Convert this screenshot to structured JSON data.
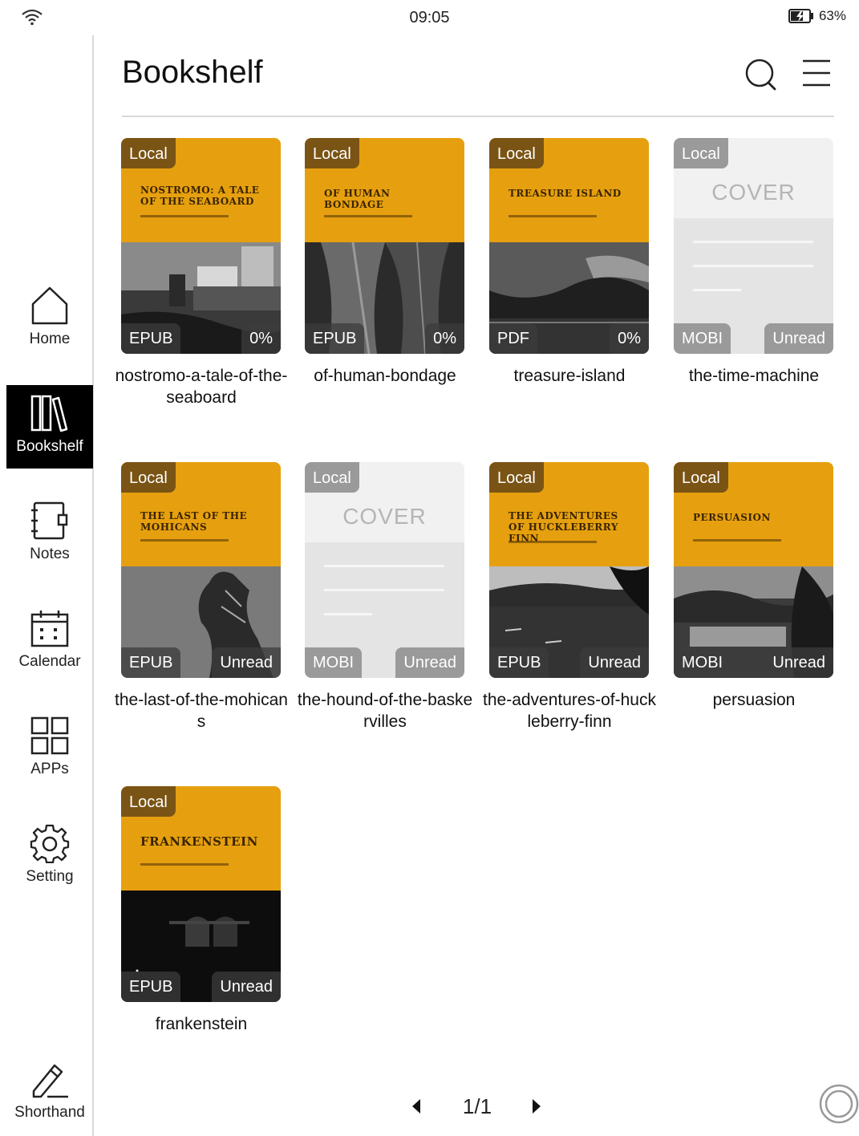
{
  "status_bar": {
    "time": "09:05",
    "battery": "63%"
  },
  "header": {
    "title": "Bookshelf"
  },
  "sidebar": {
    "items": [
      {
        "label": "Home"
      },
      {
        "label": "Bookshelf"
      },
      {
        "label": "Notes"
      },
      {
        "label": "Calendar"
      },
      {
        "label": "APPs"
      },
      {
        "label": "Setting"
      },
      {
        "label": "Shorthand"
      }
    ]
  },
  "books": [
    {
      "name": "nostromo-a-tale-of-the-seaboard",
      "source": "Local",
      "format": "EPUB",
      "status": "0%",
      "cover_title": "Nostromo: A Tale of the Seaboard",
      "cover": "image"
    },
    {
      "name": "of-human-bondage",
      "source": "Local",
      "format": "EPUB",
      "status": "0%",
      "cover_title": "Of Human Bondage",
      "cover": "image"
    },
    {
      "name": "treasure-island",
      "source": "Local",
      "format": "PDF",
      "status": "0%",
      "cover_title": "Treasure Island",
      "cover": "image"
    },
    {
      "name": "the-time-machine",
      "source": "Local",
      "format": "MOBI",
      "status": "Unread",
      "cover_title": "",
      "cover": "placeholder",
      "placeholder_word": "COVER"
    },
    {
      "name": "the-last-of-the-mohicans",
      "source": "Local",
      "format": "EPUB",
      "status": "Unread",
      "cover_title": "The Last of the Mohicans",
      "cover": "image"
    },
    {
      "name": "the-hound-of-the-baskervilles",
      "source": "Local",
      "format": "MOBI",
      "status": "Unread",
      "cover_title": "",
      "cover": "placeholder",
      "placeholder_word": "COVER"
    },
    {
      "name": "the-adventures-of-huckleberry-finn",
      "source": "Local",
      "format": "EPUB",
      "status": "Unread",
      "cover_title": "The Adventures of Huckleberry Finn",
      "cover": "image"
    },
    {
      "name": "persuasion",
      "source": "Local",
      "format": "MOBI",
      "status": "Unread",
      "cover_title": "Persuasion",
      "cover": "image"
    },
    {
      "name": "frankenstein",
      "source": "Local",
      "format": "EPUB",
      "status": "Unread",
      "cover_title": "Frankenstein",
      "cover": "image"
    }
  ],
  "pager": {
    "label": "1/1"
  },
  "colors": {
    "cover_accent": "#e6a00f",
    "local_tag": "#7a5415",
    "active_nav": "#000000"
  }
}
